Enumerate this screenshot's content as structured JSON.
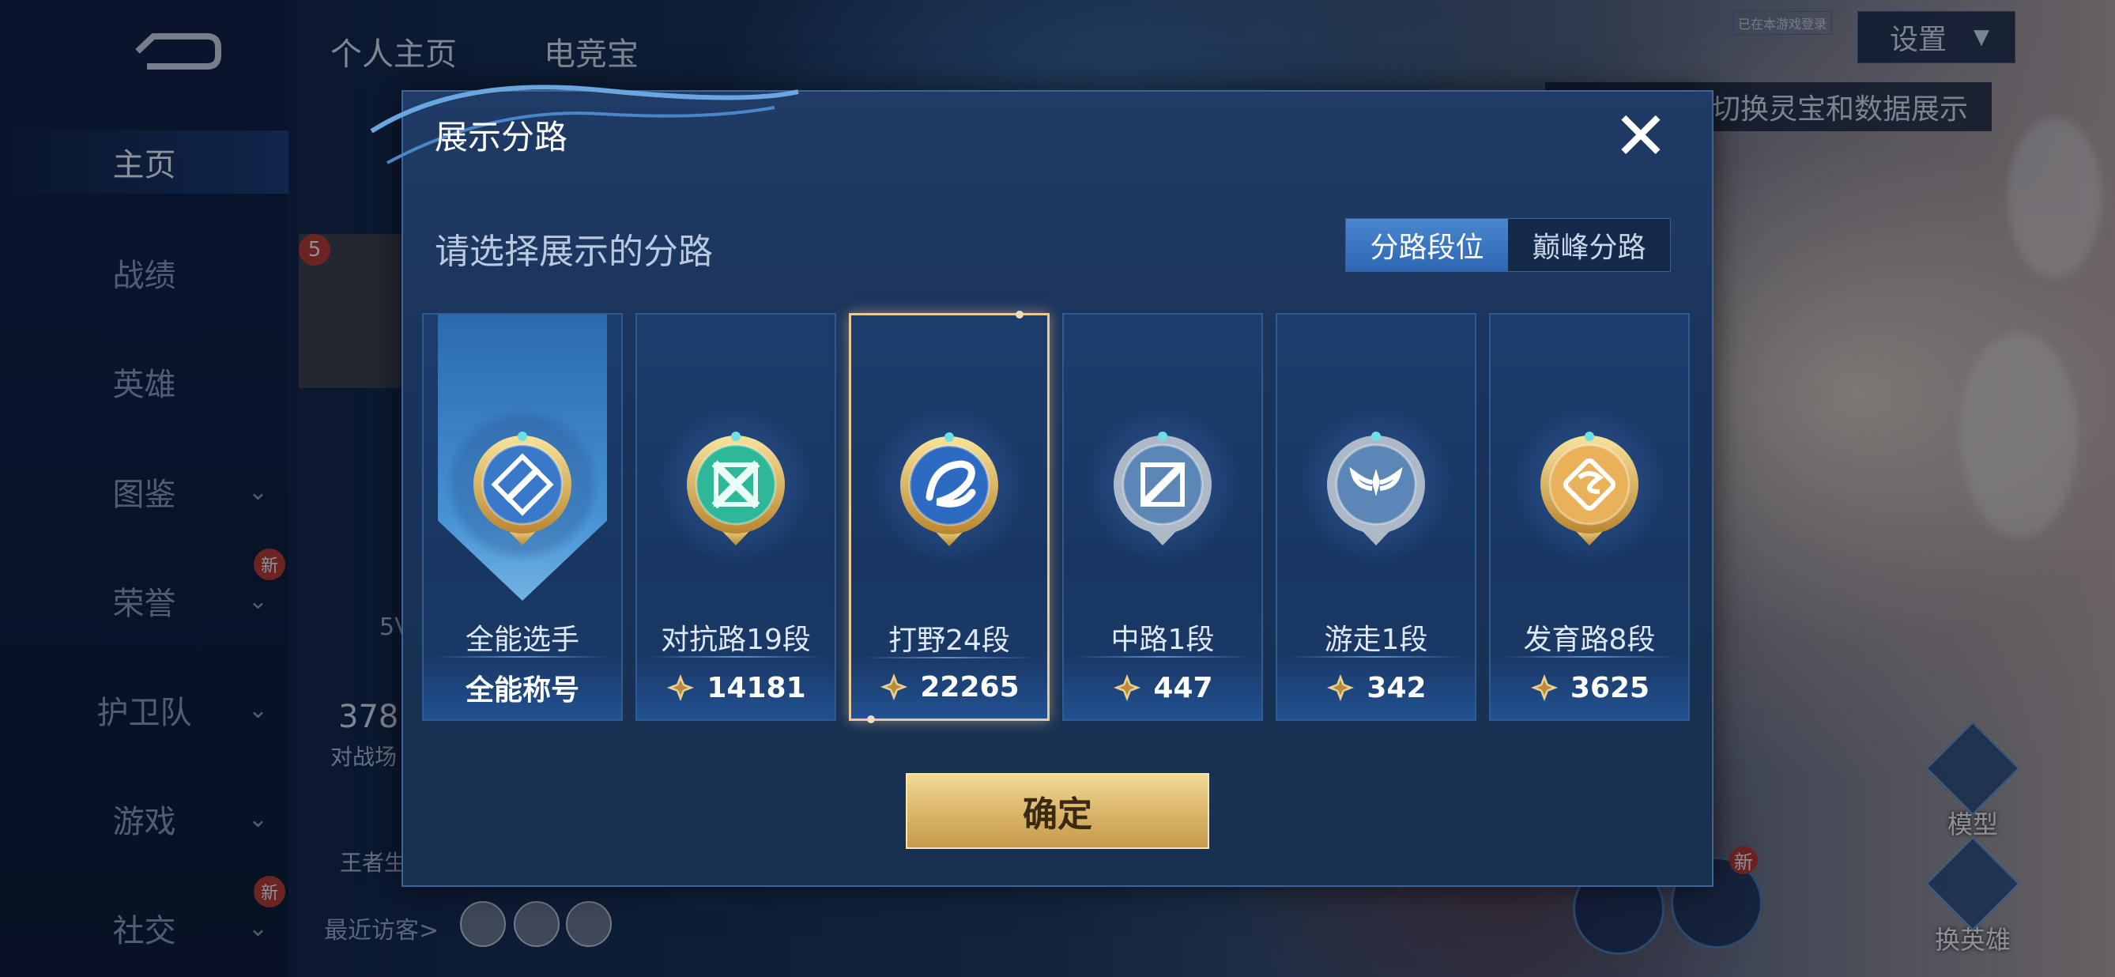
{
  "nav": {
    "items": [
      {
        "label": "主页",
        "active": true,
        "has_chevron": false,
        "new": false
      },
      {
        "label": "战绩",
        "active": false,
        "has_chevron": false,
        "new": false
      },
      {
        "label": "英雄",
        "active": false,
        "has_chevron": false,
        "new": false
      },
      {
        "label": "图鉴",
        "active": false,
        "has_chevron": true,
        "new": false
      },
      {
        "label": "荣誉",
        "active": false,
        "has_chevron": true,
        "new": true
      },
      {
        "label": "护卫队",
        "active": false,
        "has_chevron": true,
        "new": false
      },
      {
        "label": "游戏",
        "active": false,
        "has_chevron": true,
        "new": false
      },
      {
        "label": "社交",
        "active": false,
        "has_chevron": true,
        "new": true
      }
    ],
    "new_badge": "新"
  },
  "header": {
    "tabs": [
      "个人主页",
      "电竞宝"
    ],
    "settings_label": "设置",
    "hint_text": "以切换灵宝和数据展示",
    "tiny_tag": "已在本游戏登录"
  },
  "profile_bg": {
    "level_badge": "5",
    "stat_partial": "5V",
    "matches_number": "378",
    "matches_label": "对战场",
    "king_label": "王者生",
    "recent_visitors": "最近访客>"
  },
  "right_buttons": {
    "model_label": "模型",
    "swap_hero_label": "换英雄",
    "new_badge": "新"
  },
  "dialog": {
    "title": "展示分路",
    "close_icon": "close-icon",
    "subtitle": "请选择展示的分路",
    "segment": {
      "options": [
        "分路段位",
        "巅峰分路"
      ],
      "selected": "分路段位"
    },
    "cards": [
      {
        "name": "全能选手",
        "score": "全能称号",
        "emblem": "all-round-emblem",
        "show_star": false,
        "selected": false,
        "ribbon": true
      },
      {
        "name": "对抗路19段",
        "score": "14181",
        "emblem": "clash-lane-emblem",
        "show_star": true,
        "selected": false,
        "ribbon": false
      },
      {
        "name": "打野24段",
        "score": "22265",
        "emblem": "jungle-dragon-emblem",
        "show_star": true,
        "selected": true,
        "ribbon": false
      },
      {
        "name": "中路1段",
        "score": "447",
        "emblem": "mid-lane-emblem",
        "show_star": true,
        "selected": false,
        "ribbon": false
      },
      {
        "name": "游走1段",
        "score": "342",
        "emblem": "roam-wings-emblem",
        "show_star": true,
        "selected": false,
        "ribbon": false
      },
      {
        "name": "发育路8段",
        "score": "3625",
        "emblem": "farm-lane-emblem",
        "show_star": true,
        "selected": false,
        "ribbon": false
      }
    ],
    "confirm_label": "确定"
  },
  "colors": {
    "dialog_bg": "#1a335a",
    "selected_border": "#e9c89a",
    "confirm_gold": "#d9b468",
    "segment_active": "#3a76c4"
  }
}
